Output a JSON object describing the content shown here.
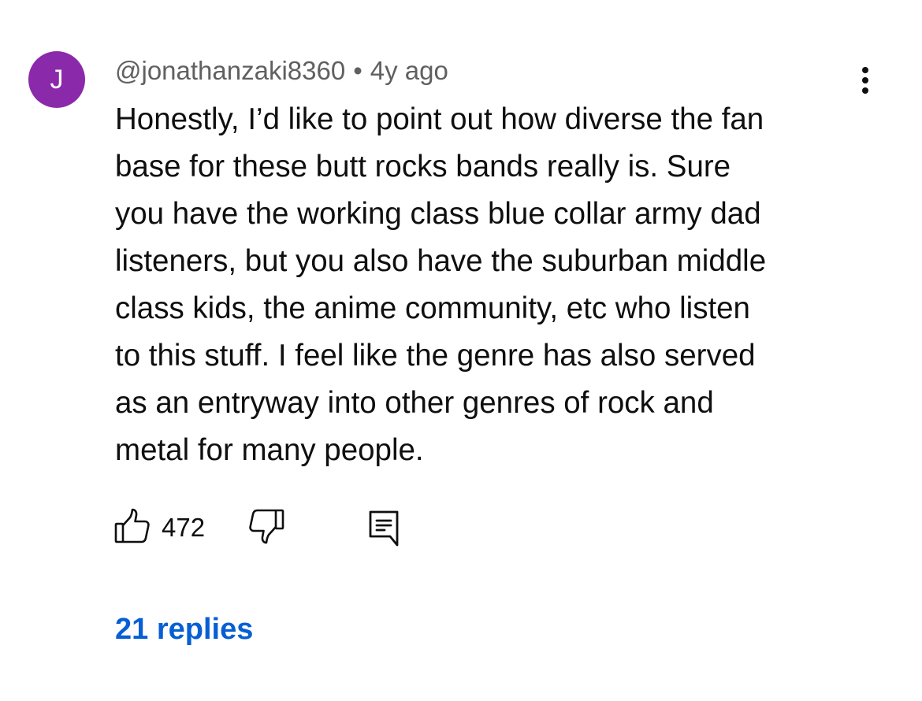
{
  "comment": {
    "avatar_initial": "J",
    "avatar_color": "#8b29ab",
    "author": "@jonathanzaki8360",
    "separator": "•",
    "time_ago": "4y ago",
    "text_lines": [
      "Honestly, I’d like to point out how diverse the fan",
      "base for these butt rocks bands really is. Sure",
      "you have the working class blue collar army dad",
      "listeners, but you also have the suburban middle",
      "class kids, the anime community, etc who listen",
      "to this stuff. I feel like the genre has also served",
      "as an entryway into other genres of rock and",
      "metal for many people."
    ],
    "like_count": "472",
    "replies_label": "21 replies",
    "replies_color": "#065fd4"
  },
  "icons": {
    "like": "thumbs-up-icon",
    "dislike": "thumbs-down-icon",
    "reply": "comment-icon",
    "menu": "more-vertical-icon"
  }
}
